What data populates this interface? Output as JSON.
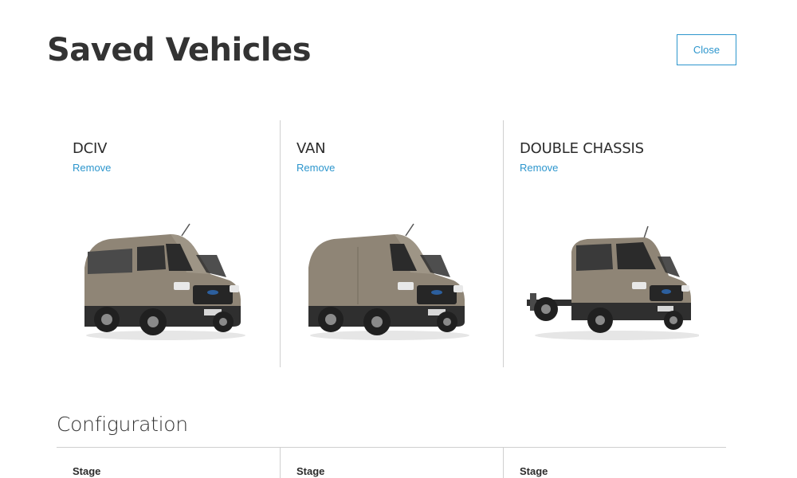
{
  "page": {
    "title": "Saved Vehicles",
    "close_label": "Close"
  },
  "colors": {
    "accent": "#2d96cd",
    "divider": "#cfcfcf",
    "vehicle_body": "#8f8576"
  },
  "vehicles": [
    {
      "name": "DCIV",
      "remove_label": "Remove",
      "image": "double-cab-van-image"
    },
    {
      "name": "VAN",
      "remove_label": "Remove",
      "image": "van-image"
    },
    {
      "name": "DOUBLE CHASSIS",
      "remove_label": "Remove",
      "image": "double-chassis-cab-image"
    }
  ],
  "configuration": {
    "title": "Configuration",
    "columns": [
      {
        "label": "Stage"
      },
      {
        "label": "Stage"
      },
      {
        "label": "Stage"
      }
    ]
  }
}
